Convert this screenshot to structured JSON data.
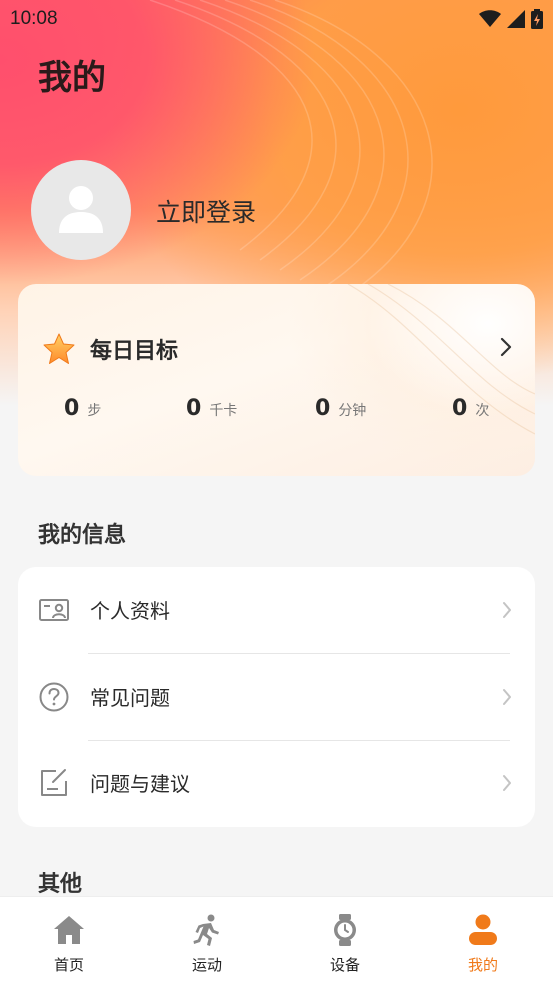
{
  "status_bar": {
    "time": "10:08"
  },
  "header": {
    "title": "我的"
  },
  "profile": {
    "login_label": "立即登录",
    "avatar_icon": "user-avatar-icon"
  },
  "daily_goal": {
    "title": "每日目标",
    "icon": "star-icon",
    "stats": [
      {
        "value": "0",
        "unit": "步"
      },
      {
        "value": "0",
        "unit": "千卡"
      },
      {
        "value": "0",
        "unit": "分钟"
      },
      {
        "value": "0",
        "unit": "次"
      }
    ]
  },
  "my_info": {
    "section_title": "我的信息",
    "items": [
      {
        "label": "个人资料",
        "icon": "profile-card-icon"
      },
      {
        "label": "常见问题",
        "icon": "question-icon"
      },
      {
        "label": "问题与建议",
        "icon": "feedback-edit-icon"
      }
    ]
  },
  "other": {
    "section_title": "其他"
  },
  "tabbar": {
    "active_color": "#f07a1a",
    "items": [
      {
        "label": "首页",
        "icon": "home-icon"
      },
      {
        "label": "运动",
        "icon": "running-icon"
      },
      {
        "label": "设备",
        "icon": "watch-icon"
      },
      {
        "label": "我的",
        "icon": "person-icon"
      }
    ]
  }
}
